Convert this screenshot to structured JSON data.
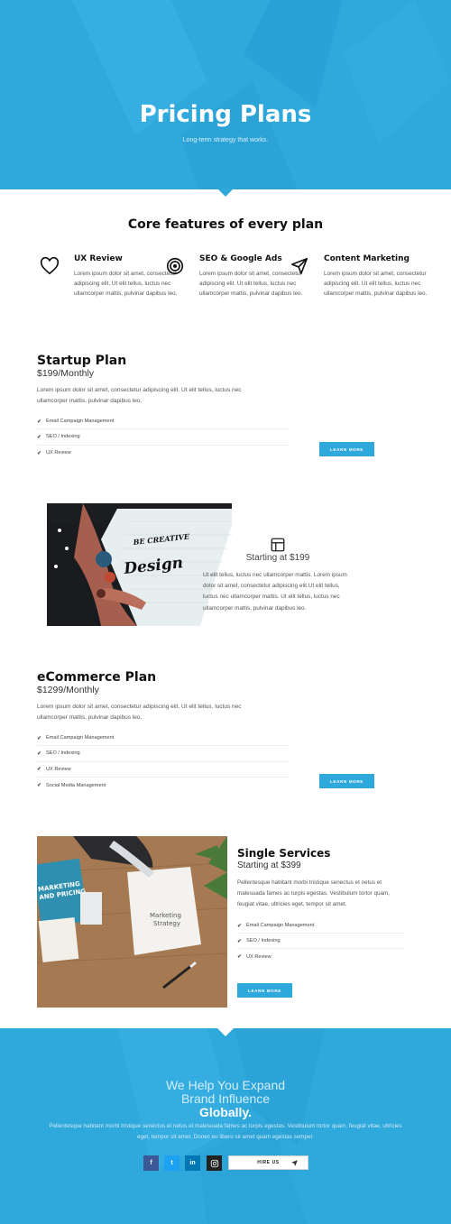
{
  "hero": {
    "title": "Pricing Plans",
    "subtitle": "Long-term strategy that works."
  },
  "core": {
    "title": "Core features of every plan",
    "features": [
      {
        "icon": "heart-icon",
        "title": "UX Review",
        "text": "Lorem ipsum dolor sit amet, consectetur adipiscing elit. Ut elit tellus, luctus nec ullamcorper mattis, pulvinar dapibus leo."
      },
      {
        "icon": "target-icon",
        "title": "SEO & Google Ads",
        "text": "Lorem ipsum dolor sit amet, consectetur adipiscing elit. Ut elit tellus, luctus nec ullamcorper mattis, pulvinar dapibus leo."
      },
      {
        "icon": "send-icon",
        "title": "Content Marketing",
        "text": "Lorem ipsum dolor sit amet, consectetur adipiscing elit. Ut elit tellus, luctus nec ullamcorper mattis, pulvinar dapibus leo."
      }
    ]
  },
  "startup": {
    "title": "Startup Plan",
    "price": "$199/Monthly",
    "desc": "Lorem ipsum dolor sit amet, consectetur adipiscing elit. Ut elit tellus, luctus nec ullamcorper mattis, pulvinar dapibus leo.",
    "items": [
      "Email Campaign Management",
      "SEO / Indexing",
      "UX Review"
    ],
    "button": "LEARN MORE"
  },
  "starting": {
    "image_lettering": [
      "BE CREATIVE",
      "Design"
    ],
    "title": "Starting at $199",
    "text": "Ut elit tellus, luctus nec ullamcorper mattis. Lorem ipsum dolor sit amet, consectetur adipiscing elit.Ut elit tellus, luctus nec ullamcorper mattis. Ut elit tellus, luctus nec ullamcorper mattis, pulvinar dapibus leo."
  },
  "ecommerce": {
    "title": "eCommerce Plan",
    "price": "$1299/Monthly",
    "desc": "Lorem ipsum dolor sit amet, consectetur adipiscing elit. Ut elit tellus, luctus nec ullamcorper mattis, pulvinar dapibus leo.",
    "items": [
      "Email Campaign Management",
      "SEO / Indexing",
      "UX Review",
      "Social Media Management"
    ],
    "button": "LEARN MORE"
  },
  "single": {
    "image_lettering": [
      "MARKETING AND PRICING",
      "Marketing Strategy"
    ],
    "title": "Single Services",
    "price": "Starting at $399",
    "desc": "Pellentesque habitant morbi tristique senectus et netus et malesuada fames ac turpis egestas. Vestibulum tortor quam, feugiat vitae, ultricies eget, tempor sit amet.",
    "items": [
      "Email Campaign Management",
      "SEO / Indexing",
      "UX Review"
    ],
    "button": "LEARN MORE"
  },
  "footer": {
    "line1": "We Help You Expand",
    "line2": "Brand Influence",
    "line3": "Globally.",
    "text": "Pellentesque habitant morbi tristique senectus et netus et malesuada fames ac turpis egestas. Vestibulum tortor quam, feugiat vitae, ultricies eget, tempor sit amet. Donec eu libero sit amet quam egestas semper.",
    "social": [
      {
        "icon": "facebook-icon",
        "glyph": "f",
        "color": "#3b5998"
      },
      {
        "icon": "twitter-icon",
        "glyph": "t",
        "color": "#1da1f2"
      },
      {
        "icon": "linkedin-icon",
        "glyph": "in",
        "color": "#0077b5"
      },
      {
        "icon": "instagram-icon",
        "glyph": "ig",
        "color": "#222222"
      }
    ],
    "hire_label": "HIRE US"
  },
  "colors": {
    "accent": "#2fa8dc",
    "dark": "#111111"
  }
}
